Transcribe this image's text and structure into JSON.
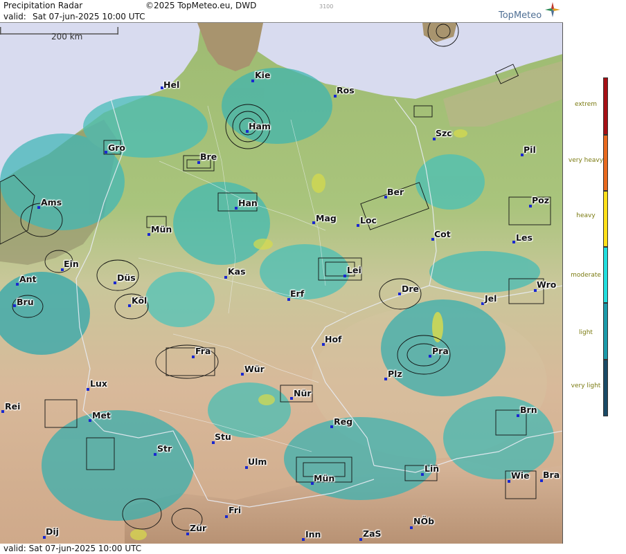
{
  "header": {
    "title": "Precipitation Radar",
    "copyright": "©2025 TopMeteo.eu, DWD",
    "id_label": "3100",
    "valid_prefix": "valid:",
    "valid_time": "Sat  07-jun-2025 10:00 UTC",
    "logo_text": "TopMeteo"
  },
  "footer": {
    "valid_text": "valid:  Sat  07-jun-2025 10:00 UTC"
  },
  "map": {
    "scale_bar_label": "200 km",
    "cities": [
      {
        "name": "Hel"
      },
      {
        "name": "Kie"
      },
      {
        "name": "Ros"
      },
      {
        "name": "Ham"
      },
      {
        "name": "Szc"
      },
      {
        "name": "Gro"
      },
      {
        "name": "Bre"
      },
      {
        "name": "Pil"
      },
      {
        "name": "Ber"
      },
      {
        "name": "Poz"
      },
      {
        "name": "Ams"
      },
      {
        "name": "Han"
      },
      {
        "name": "Mag"
      },
      {
        "name": "Loc"
      },
      {
        "name": "Mün"
      },
      {
        "name": "Cot"
      },
      {
        "name": "Les"
      },
      {
        "name": "Ein"
      },
      {
        "name": "Kas"
      },
      {
        "name": "Lei"
      },
      {
        "name": "Ant"
      },
      {
        "name": "Düs"
      },
      {
        "name": "Wro"
      },
      {
        "name": "Dre"
      },
      {
        "name": "Erf"
      },
      {
        "name": "Bru"
      },
      {
        "name": "Köl"
      },
      {
        "name": "Jel"
      },
      {
        "name": "Hof"
      },
      {
        "name": "Fra"
      },
      {
        "name": "Pra"
      },
      {
        "name": "Wür"
      },
      {
        "name": "Plz"
      },
      {
        "name": "Lux"
      },
      {
        "name": "Nür"
      },
      {
        "name": "Rei"
      },
      {
        "name": "Brn"
      },
      {
        "name": "Met"
      },
      {
        "name": "Reg"
      },
      {
        "name": "Stu"
      },
      {
        "name": "Str"
      },
      {
        "name": "Lin"
      },
      {
        "name": "Ulm"
      },
      {
        "name": "Wie"
      },
      {
        "name": "Bra"
      },
      {
        "name": "Mün"
      },
      {
        "name": "Fri"
      },
      {
        "name": "NÖb"
      },
      {
        "name": "Zür"
      },
      {
        "name": "Dij"
      },
      {
        "name": "Inn"
      },
      {
        "name": "ZaS"
      }
    ]
  },
  "legend": {
    "items": [
      {
        "label": "extrem",
        "color": "#a50f15"
      },
      {
        "label": "very heavy",
        "color": "#e8691e"
      },
      {
        "label": "heavy",
        "color": "#ffe01a"
      },
      {
        "label": "moderate",
        "color": "#22dede"
      },
      {
        "label": "light",
        "color": "#1c9aa9"
      },
      {
        "label": "very light",
        "color": "#1a4a66"
      }
    ]
  }
}
